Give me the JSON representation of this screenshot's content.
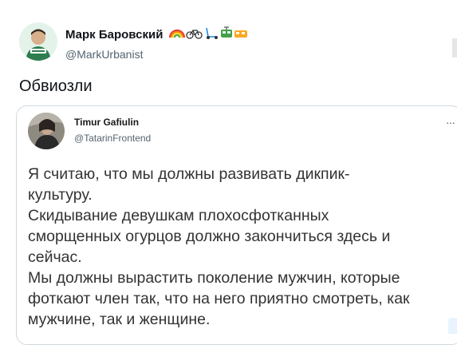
{
  "tweet": {
    "author": {
      "display_name": "Марк Баровский",
      "handle": "@MarkUrbanist",
      "name_emojis": [
        "rainbow-icon",
        "bicycle-icon",
        "kick-scooter-icon",
        "tram-icon",
        "train-icon"
      ]
    },
    "text": "Обвиозли",
    "more_icon": "more-dots-icon"
  },
  "quote": {
    "author": {
      "display_name": "Timur Gafiulin",
      "handle": "@TatarinFrontend"
    },
    "more_icon": "more-dots-icon",
    "text_lines": [
      "Я считаю, что мы должны развивать дикпик-",
      "культуру.",
      "Скидывание девушкам плохосфотканных",
      "сморщенных огурцов должно закончиться здесь и",
      "сейчас.",
      "Мы должны вырастить поколение мужчин, которые",
      "фоткают член так, что на него приятно смотреть, как",
      "мужчине, так и женщине."
    ]
  }
}
